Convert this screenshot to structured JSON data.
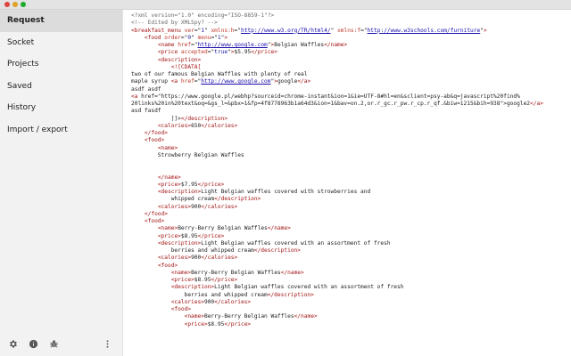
{
  "colors": {
    "titlebar": "#e3e3e3",
    "sidebar_bg": "#f2f2f2",
    "sidebar_active": "#dcdcdc",
    "tag": "#a31515",
    "attribute": "#c0392b",
    "value": "#1a1aa6",
    "link": "#1a0dab"
  },
  "window": {
    "controls": [
      {
        "name": "close",
        "color": "#e0443e"
      },
      {
        "name": "minimize",
        "color": "#dea123"
      },
      {
        "name": "maximize",
        "color": "#1aab29"
      }
    ]
  },
  "sidebar": {
    "items": [
      {
        "label": "Request",
        "active": true
      },
      {
        "label": "Socket",
        "active": false
      },
      {
        "label": "Projects",
        "active": false
      },
      {
        "label": "Saved",
        "active": false
      },
      {
        "label": "History",
        "active": false
      },
      {
        "label": "Import / export",
        "active": false
      }
    ],
    "footer_icons": [
      "gear-icon",
      "info-icon",
      "bug-icon",
      "more-vertical-icon"
    ]
  },
  "editor": {
    "lines": [
      "<?xml version=\"1.0\" encoding=\"ISO-8859-1\"?>",
      "<!-- Edited by XMLSpy? -->",
      "<breakfast_menu ver=\"1\" xmlns:h=\"http://www.w3.org/TR/html4/\" xmlns:f=\"http://www.w3schools.com/furniture\">",
      "    <food order=\"0\" menu=\"1\">",
      "        <name href=\"http://www.google.com\">Belgian Waffles</name>",
      "        <price accepted=\"true\">$5.95</price>",
      "        <description>",
      "            <![CDATA[",
      "two of our famous Belgian Waffles with plenty of real",
      "maple syrup <a href=\"http://www.google.com\">google</a>",
      "asdf asdf",
      "<a href=\"https://www.google.pl/webhp?sourceid=chrome-instant&ion=1&ie=UTF-8#hl=en&sclient=psy-ab&q=javascript%20find%",
      "20links%20in%20text&oq=&gs_l=&pbx=1&fp=4f8778963b1a64d3&ion=1&bav=on.2,or.r_gc.r_pw.r_cp.r_qf.&biw=1215&bih=938\">google2</a>",
      "asd fasdf",
      "            ]]></description>",
      "        <calories>650</calories>",
      "    </food>",
      "    <food>",
      "        <name>",
      "        Strowberry Belgian Waffles",
      "",
      "",
      "        </name>",
      "        <price>$7.95</price>",
      "        <description>Light Belgian waffles covered with strowberries and",
      "            whipped cream</description>",
      "        <calories>900</calories>",
      "    </food>",
      "    <food>",
      "        <name>Berry-Berry Belgian Waffles</name>",
      "        <price>$8.95</price>",
      "        <description>Light Belgian waffles covered with an assortment of fresh",
      "            berries and whipped cream</description>",
      "        <calories>900</calories>",
      "        <food>",
      "            <name>Berry-Berry Belgian Waffles</name>",
      "            <price>$8.95</price>",
      "            <description>Light Belgian waffles covered with an assortment of fresh",
      "                berries and whipped cream</description>",
      "            <calories>900</calories>",
      "            <food>",
      "                <name>Berry-Berry Belgian Waffles</name>",
      "                <price>$8.95</price>"
    ]
  }
}
